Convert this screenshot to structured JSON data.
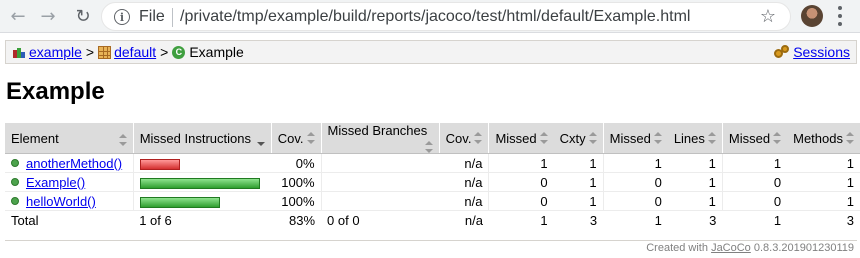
{
  "browser": {
    "file_label": "File",
    "url": "/private/tmp/example/build/reports/jacoco/test/html/default/Example.html"
  },
  "breadcrumb": {
    "report": "example",
    "package": "default",
    "current": "Example",
    "sessions": "Sessions",
    "separator": ">"
  },
  "page_title": "Example",
  "table": {
    "headers": [
      "Element",
      "Missed Instructions",
      "Cov.",
      "Missed Branches",
      "Cov.",
      "Missed",
      "Cxty",
      "Missed",
      "Lines",
      "Missed",
      "Methods"
    ],
    "rows": [
      {
        "element": "anotherMethod()",
        "coverage": 0.0,
        "bar_color": "red",
        "cov": "0%",
        "branch_cov": "n/a",
        "missed_cxty": "1",
        "cxty": "1",
        "missed_lines": "1",
        "lines": "1",
        "missed_methods": "1",
        "methods": "1"
      },
      {
        "element": "Example()",
        "coverage": 1.0,
        "bar_color": "green",
        "cov": "100%",
        "branch_cov": "n/a",
        "missed_cxty": "0",
        "cxty": "1",
        "missed_lines": "0",
        "lines": "1",
        "missed_methods": "0",
        "methods": "1"
      },
      {
        "element": "helloWorld()",
        "coverage": 1.0,
        "bar_color": "green",
        "cov": "100%",
        "branch_cov": "n/a",
        "missed_cxty": "0",
        "cxty": "1",
        "missed_lines": "0",
        "lines": "1",
        "missed_methods": "0",
        "methods": "1"
      }
    ],
    "bar_relative_widths": [
      0.33,
      1.0,
      0.67
    ],
    "total": {
      "label": "Total",
      "missed_instructions": "1 of 6",
      "cov": "83%",
      "missed_branches": "0 of 0",
      "branch_cov": "n/a",
      "missed_cxty": "1",
      "cxty": "3",
      "missed_lines": "1",
      "lines": "3",
      "missed_methods": "1",
      "methods": "3"
    }
  },
  "footer": {
    "prefix": "Created with",
    "link": "JaCoCo",
    "version": "0.8.3.201901230119"
  },
  "colors": {
    "bar_red": "#d43030",
    "bar_green": "#2f9e2f",
    "link": "#0000ee",
    "header_bg": "#dcdcdc"
  }
}
